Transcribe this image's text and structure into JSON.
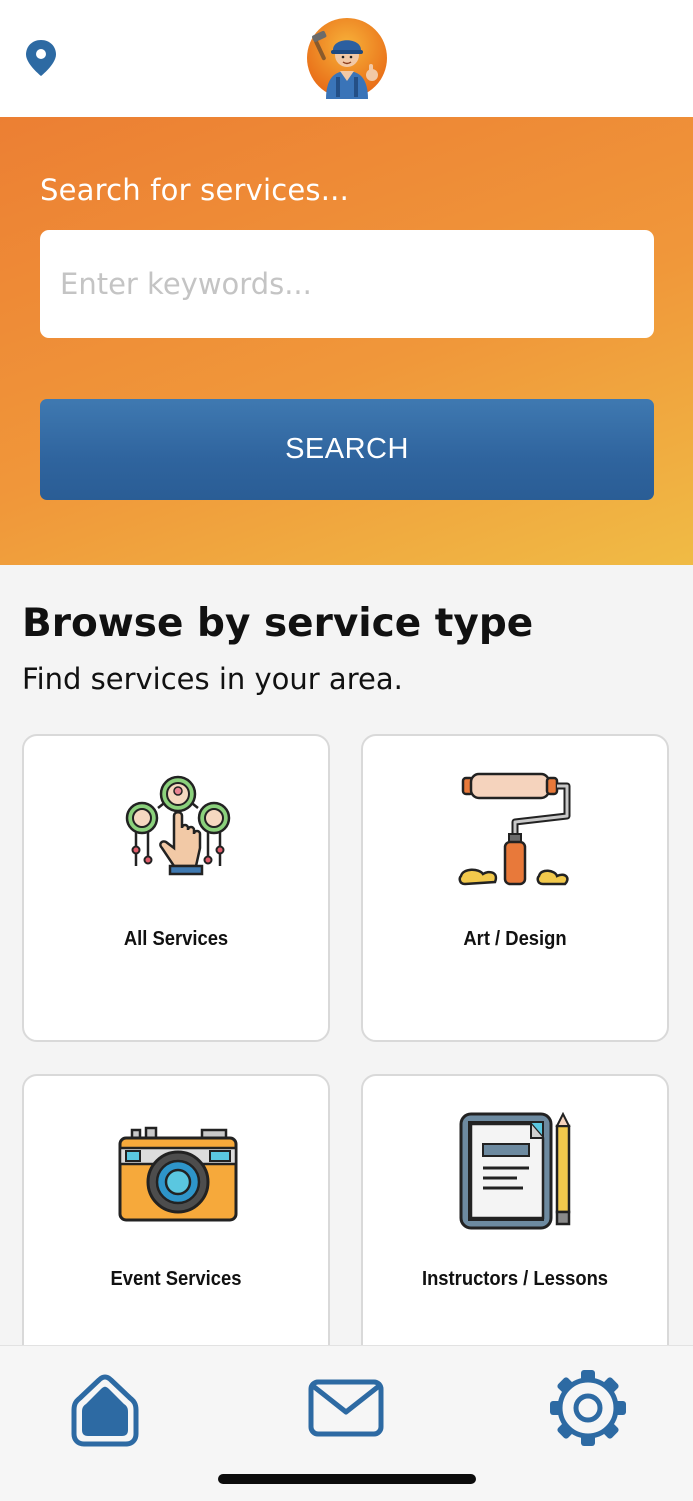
{
  "header": {
    "location_icon": "location-pin-icon",
    "avatar_icon": "handyman-avatar-icon"
  },
  "search": {
    "label": "Search for services...",
    "placeholder": "Enter keywords...",
    "value": "",
    "button_label": "SEARCH"
  },
  "browse": {
    "title": "Browse by service type",
    "subtitle": "Find services in your area.",
    "categories": [
      {
        "label": "All Services",
        "icon": "people-network-icon"
      },
      {
        "label": "Art / Design",
        "icon": "paint-roller-icon"
      },
      {
        "label": "Event Services",
        "icon": "camera-icon"
      },
      {
        "label": "Instructors / Lessons",
        "icon": "tablet-notes-icon"
      }
    ]
  },
  "bottom_nav": {
    "items": [
      {
        "icon": "home-icon"
      },
      {
        "icon": "mail-icon"
      },
      {
        "icon": "gear-icon"
      }
    ]
  },
  "colors": {
    "accent_orange": "#ec7f33",
    "accent_yellow": "#f0bb45",
    "primary_blue": "#2f649e",
    "nav_blue": "#2d6aa3"
  }
}
